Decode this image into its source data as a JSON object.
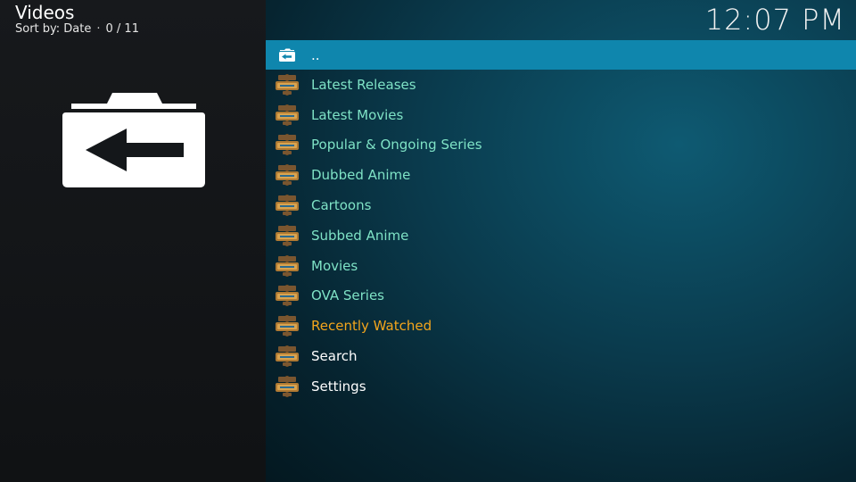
{
  "header": {
    "title": "Videos",
    "sort_label": "Sort by: Date",
    "separator": "·",
    "position": "0 / 11"
  },
  "clock": {
    "time": "12:07 PM"
  },
  "big_icon": {
    "icon": "folder-back-icon"
  },
  "list": {
    "items": [
      {
        "label": "..",
        "icon": "folder-back-icon",
        "focused": true
      },
      {
        "label": "Latest Releases",
        "icon": "addon-wooden-sign-icon"
      },
      {
        "label": "Latest Movies",
        "icon": "addon-wooden-sign-icon"
      },
      {
        "label": "Popular & Ongoing Series",
        "icon": "addon-wooden-sign-icon"
      },
      {
        "label": "Dubbed Anime",
        "icon": "addon-wooden-sign-icon"
      },
      {
        "label": "Cartoons",
        "icon": "addon-wooden-sign-icon"
      },
      {
        "label": "Subbed Anime",
        "icon": "addon-wooden-sign-icon"
      },
      {
        "label": "Movies",
        "icon": "addon-wooden-sign-icon"
      },
      {
        "label": "OVA Series",
        "icon": "addon-wooden-sign-icon"
      },
      {
        "label": "Recently Watched",
        "icon": "addon-wooden-sign-icon"
      },
      {
        "label": "Search",
        "icon": "addon-wooden-sign-icon"
      },
      {
        "label": "Settings",
        "icon": "addon-wooden-sign-icon"
      }
    ]
  },
  "colors": {
    "focus_bar": "#0f86ad",
    "item_text": "#7fe3c6",
    "recently_watched_text": "#f3a51c",
    "plain_text": "#ffffff"
  }
}
